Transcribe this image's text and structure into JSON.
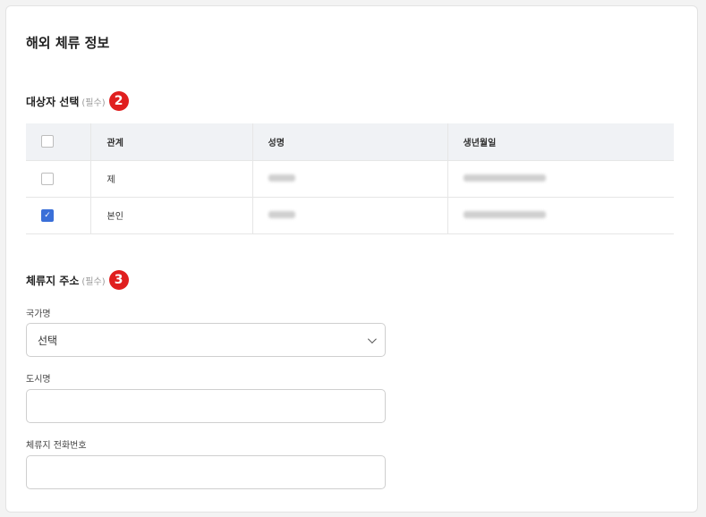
{
  "page": {
    "title": "해외 체류 정보"
  },
  "subject": {
    "title": "대상자 선택",
    "required": "(필수)",
    "step": "2",
    "table": {
      "headers": [
        "관계",
        "성명",
        "생년월일"
      ],
      "rows": [
        {
          "relation": "제",
          "checked": false
        },
        {
          "relation": "본인",
          "checked": true
        }
      ]
    }
  },
  "address": {
    "title": "체류지 주소",
    "required": "(필수)",
    "step": "3",
    "country": {
      "label": "국가명",
      "value": "선택"
    },
    "city": {
      "label": "도시명",
      "value": ""
    },
    "phone": {
      "label": "체류지 전화번호",
      "value": ""
    }
  },
  "icons": {
    "check": "check-icon",
    "dropdown": "chevron-down-icon"
  },
  "colors": {
    "step_badge": "#e01f1f",
    "checkbox_checked": "#3a6fd8",
    "header_bg": "#f0f2f5"
  }
}
